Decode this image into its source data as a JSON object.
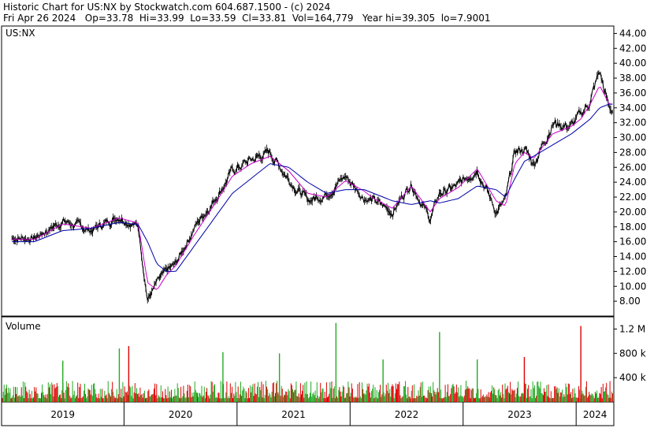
{
  "header": {
    "line1": "Historic Chart for US:NX by Stockwatch.com 604.687.1500 - (c) 2024",
    "line2": "Fri Apr 26 2024   Op=33.78  Hi=33.99  Lo=33.59  Cl=33.81  Vol=164,779   Year hi=39.305  lo=7.9001"
  },
  "colors": {
    "price": "#000000",
    "ma_short": "#cc00cc",
    "ma_long": "#0000aa",
    "vol_up": "#22aa22",
    "vol_down": "#dd0000",
    "frame": "#000000"
  },
  "chart_data": [
    {
      "type": "line",
      "panel": "price",
      "title": "US:NX",
      "ylim": [
        6.0,
        45.0
      ],
      "y_ticks": [
        "44.00",
        "42.00",
        "40.00",
        "38.00",
        "36.00",
        "34.00",
        "32.00",
        "30.00",
        "28.00",
        "26.00",
        "24.00",
        "22.00",
        "20.00",
        "18.00",
        "16.00",
        "14.00",
        "12.00",
        "10.00",
        "8.00"
      ],
      "x_ticks": [
        "2019",
        "2020",
        "2021",
        "2022",
        "2023",
        "2024"
      ],
      "x": [
        "2019-03",
        "2019-06",
        "2019-09",
        "2019-12",
        "2020-02",
        "2020-03",
        "2020-04",
        "2020-05",
        "2020-06",
        "2020-08",
        "2020-10",
        "2020-12",
        "2021-02",
        "2021-04",
        "2021-06",
        "2021-08",
        "2021-10",
        "2021-12",
        "2022-02",
        "2022-03",
        "2022-05",
        "2022-07",
        "2022-09",
        "2022-10",
        "2022-12",
        "2023-02",
        "2023-04",
        "2023-05",
        "2023-06",
        "2023-07",
        "2023-08",
        "2023-10",
        "2023-12",
        "2024-01",
        "2024-02",
        "2024-03",
        "2024-04"
      ],
      "series": [
        {
          "name": "",
          "role": "price",
          "values": [
            16.5,
            18.8,
            17.5,
            19.5,
            18.0,
            8.2,
            10.5,
            12.0,
            13.0,
            18.0,
            21.5,
            25.5,
            27.0,
            28.0,
            24.5,
            21.5,
            22.5,
            24.8,
            22.0,
            21.5,
            20.0,
            24.0,
            19.0,
            22.5,
            23.5,
            26.0,
            20.0,
            21.5,
            28.0,
            28.5,
            26.5,
            32.0,
            31.5,
            33.0,
            35.0,
            38.8,
            33.8
          ]
        },
        {
          "name": "",
          "role": "ma_short",
          "values": [
            16.3,
            18.4,
            17.8,
            19.2,
            18.5,
            10.5,
            9.5,
            11.5,
            12.8,
            17.0,
            20.8,
            24.8,
            26.5,
            27.5,
            25.5,
            22.5,
            22.0,
            24.2,
            22.8,
            21.8,
            20.5,
            23.5,
            20.0,
            21.8,
            23.3,
            25.8,
            21.5,
            20.8,
            26.5,
            28.0,
            27.2,
            30.5,
            31.5,
            32.5,
            34.5,
            37.0,
            34.5
          ]
        },
        {
          "name": "",
          "role": "ma_long",
          "values": [
            16.0,
            17.5,
            17.8,
            18.6,
            18.3,
            16.0,
            13.0,
            12.0,
            12.0,
            15.5,
            19.0,
            22.5,
            24.5,
            26.5,
            26.0,
            24.0,
            22.5,
            23.0,
            23.0,
            22.5,
            21.5,
            21.0,
            21.5,
            21.2,
            21.8,
            23.5,
            23.0,
            22.0,
            24.5,
            26.8,
            27.5,
            29.0,
            30.5,
            31.5,
            32.5,
            34.0,
            34.5
          ]
        }
      ]
    },
    {
      "type": "bar",
      "panel": "volume",
      "title": "Volume",
      "ylim": [
        0,
        1400000
      ],
      "y_ticks": [
        "1.2 M",
        "800 k",
        "400 k"
      ],
      "x_ticks": [
        "2019",
        "2020",
        "2021",
        "2022",
        "2023",
        "2024"
      ],
      "spikes": [
        {
          "date": "2019-06",
          "value": 680000,
          "dir": "up"
        },
        {
          "date": "2019-12",
          "value": 880000,
          "dir": "up"
        },
        {
          "date": "2020-01",
          "value": 920000,
          "dir": "down"
        },
        {
          "date": "2020-11",
          "value": 820000,
          "dir": "up"
        },
        {
          "date": "2021-05",
          "value": 800000,
          "dir": "up"
        },
        {
          "date": "2021-11",
          "value": 1300000,
          "dir": "up"
        },
        {
          "date": "2022-04",
          "value": 700000,
          "dir": "up"
        },
        {
          "date": "2022-10",
          "value": 1150000,
          "dir": "up"
        },
        {
          "date": "2023-02",
          "value": 700000,
          "dir": "up"
        },
        {
          "date": "2023-07",
          "value": 740000,
          "dir": "down"
        },
        {
          "date": "2024-01",
          "value": 1250000,
          "dir": "down"
        }
      ],
      "typical_range": [
        60000,
        350000
      ]
    }
  ]
}
